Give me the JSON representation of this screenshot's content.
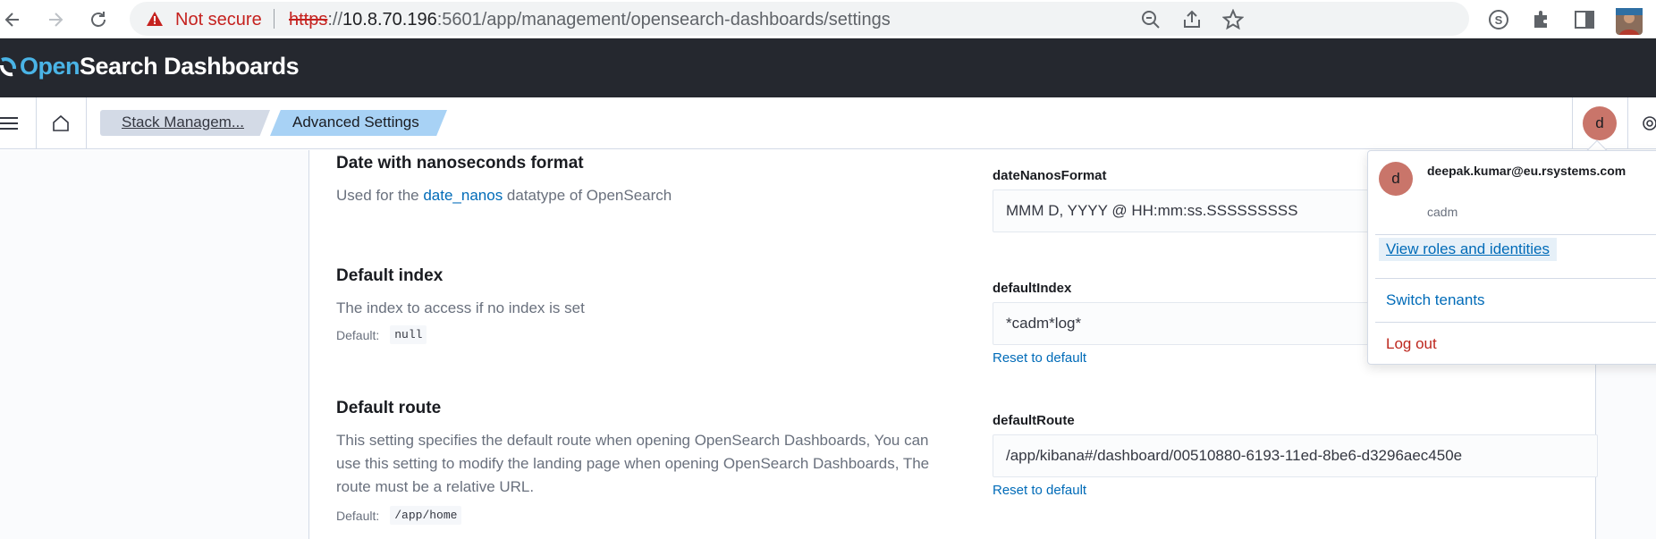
{
  "browser": {
    "security_label": "Not secure",
    "url_protocol": "https",
    "url_sep": "://",
    "url_host": "10.8.70.196",
    "url_rest": ":5601/app/management/opensearch-dashboards/settings"
  },
  "header": {
    "logo_open": "Open",
    "logo_rest": "Search Dashboards"
  },
  "breadcrumbs": {
    "items": [
      {
        "label": "Stack Managem..."
      },
      {
        "label": "Advanced Settings"
      }
    ]
  },
  "user": {
    "initial": "d",
    "email": "deepak.kumar@eu.rsystems.com",
    "tenant": "cadm"
  },
  "menu": {
    "view_roles": "View roles and identities",
    "switch_tenants": "Switch tenants",
    "logout": "Log out"
  },
  "settings": [
    {
      "title": "Date with nanoseconds format",
      "desc_pre": "Used for the ",
      "desc_link": "date_nanos",
      "desc_post": " datatype of OpenSearch",
      "key": "dateNanosFormat",
      "value": "MMM D, YYYY @ HH:mm:ss.SSSSSSSSS"
    },
    {
      "title": "Default index",
      "desc": "The index to access if no index is set",
      "default_label": "Default:",
      "default_value": "null",
      "key": "defaultIndex",
      "value": "*cadm*log*",
      "reset_label": "Reset to default"
    },
    {
      "title": "Default route",
      "desc": "This setting specifies the default route when opening OpenSearch Dashboards, You can use this setting to modify the landing page when opening OpenSearch Dashboards, The route must be a relative URL.",
      "default_label": "Default:",
      "default_value": "/app/home",
      "key": "defaultRoute",
      "value": "/app/kibana#/dashboard/00510880-6193-11ed-8be6-d3296aec450e",
      "reset_label": "Reset to default"
    }
  ],
  "colors": {
    "header_bg": "#25282f",
    "link": "#006bb8",
    "danger": "#bd271e",
    "avatar": "#c9756a",
    "crumb_active": "#a8d2f5"
  }
}
